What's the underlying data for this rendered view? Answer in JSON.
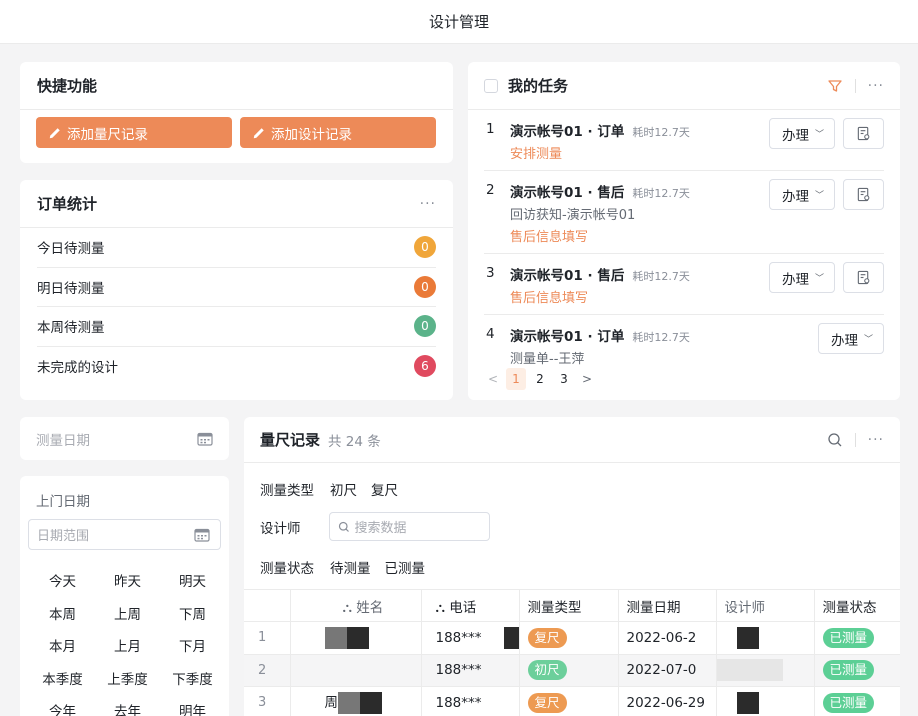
{
  "header": {
    "title": "设计管理"
  },
  "quick": {
    "title": "快捷功能",
    "buttons": [
      {
        "label": "添加量尺记录"
      },
      {
        "label": "添加设计记录"
      }
    ],
    "accent": "#ed8a58"
  },
  "stats": {
    "title": "订单统计",
    "more": "···",
    "rows": [
      {
        "label": "今日待测量",
        "count": "0",
        "color": "#f0a63a"
      },
      {
        "label": "明日待测量",
        "count": "0",
        "color": "#ea7a38"
      },
      {
        "label": "本周待测量",
        "count": "0",
        "color": "#5bb38a"
      },
      {
        "label": "未完成的设计",
        "count": "6",
        "color": "#e04a5f"
      }
    ]
  },
  "tasks": {
    "title": "我的任务",
    "more": "···",
    "action_label": "办理",
    "items": [
      {
        "num": "1",
        "title": "演示帐号01 · 订单",
        "time": "耗时12.7天",
        "sub": "",
        "link": "安排测量",
        "has_icon_btn": true
      },
      {
        "num": "2",
        "title": "演示帐号01 · 售后",
        "time": "耗时12.7天",
        "sub": "回访获知-演示帐号01",
        "link": "售后信息填写",
        "has_icon_btn": true
      },
      {
        "num": "3",
        "title": "演示帐号01 · 售后",
        "time": "耗时12.7天",
        "sub": "",
        "link": "售后信息填写",
        "has_icon_btn": true
      },
      {
        "num": "4",
        "title": "演示帐号01 · 订单",
        "time": "耗时12.7天",
        "sub": "测量单--王萍",
        "link": "",
        "has_icon_btn": false
      }
    ],
    "pager": {
      "pages": [
        "1",
        "2",
        "3"
      ],
      "active": "1",
      "prev": "<",
      "next": ">"
    }
  },
  "measure_date": {
    "placeholder": "测量日期"
  },
  "visit": {
    "title": "上门日期",
    "range_placeholder": "日期范围",
    "presets": [
      "今天",
      "昨天",
      "明天",
      "本周",
      "上周",
      "下周",
      "本月",
      "上月",
      "下月",
      "本季度",
      "上季度",
      "下季度",
      "今年",
      "去年",
      "明年"
    ]
  },
  "records": {
    "title": "量尺记录",
    "count": "共 24 条",
    "more": "···",
    "filters": {
      "type_label": "测量类型",
      "type_options": [
        "初尺",
        "复尺"
      ],
      "designer_label": "设计师",
      "search_placeholder": "搜索数据",
      "status_label": "测量状态",
      "status_options": [
        "待测量",
        "已测量"
      ]
    },
    "columns": [
      "姓名",
      "电话",
      "测量类型",
      "测量日期",
      "设计师",
      "测量状态"
    ],
    "rows": [
      {
        "idx": "1",
        "phone": "188***",
        "type": "复尺",
        "type_color": "#ed9a52",
        "date": "2022-06-2",
        "status": "已测量"
      },
      {
        "idx": "2",
        "phone": "188***",
        "type": "初尺",
        "type_color": "#6ccf9b",
        "date": "2022-07-0",
        "status": "已测量"
      },
      {
        "idx": "3",
        "name_prefix": "周",
        "phone": "188***",
        "type": "复尺",
        "type_color": "#ed9a52",
        "date": "2022-06-29",
        "status": "已测量"
      }
    ],
    "status_color": "#5ccf95"
  }
}
